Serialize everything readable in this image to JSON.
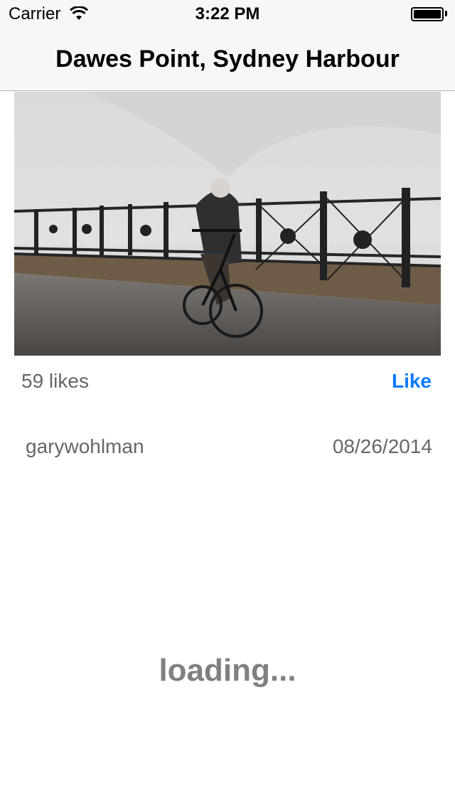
{
  "status_bar": {
    "carrier": "Carrier",
    "time": "3:22 PM"
  },
  "nav": {
    "title": "Dawes Point, Sydney Harbour"
  },
  "photo": {
    "icon": "photo-cyclist-railing"
  },
  "post": {
    "likes": "59 likes",
    "like_label": "Like",
    "username": "garywohlman",
    "date": "08/26/2014"
  },
  "loading": {
    "text": "loading..."
  },
  "colors": {
    "accent": "#0a7aff",
    "secondary_text": "#666666",
    "loading_text": "#808080",
    "navbar_bg": "#f7f7f7"
  }
}
